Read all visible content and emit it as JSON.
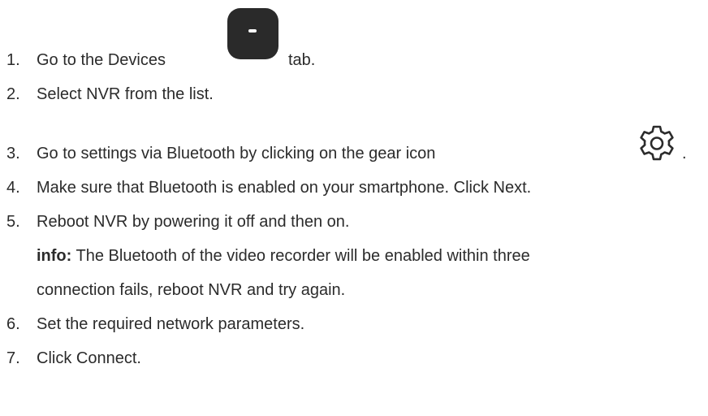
{
  "steps": [
    {
      "num": "1.",
      "before": "Go to the Devices",
      "after": "tab."
    },
    {
      "num": "2.",
      "text": "Select NVR from the list."
    },
    {
      "num": "3.",
      "before": "Go to settings via Bluetooth by clicking on the gear icon",
      "after": "."
    },
    {
      "num": "4.",
      "text": "Make sure that Bluetooth is enabled on your smartphone. Click Next."
    },
    {
      "num": "5.",
      "text": "Reboot NVR by powering it off and then on."
    },
    {
      "num": "6.",
      "text": "Set the required network parameters."
    },
    {
      "num": "7.",
      "text": "Click Connect."
    }
  ],
  "info": {
    "label": "info:",
    "line1": "The Bluetooth of the video recorder will be enabled within three",
    "line2": "connection fails, reboot NVR and try again."
  },
  "icons": {
    "devices_tab": "devices-tab-icon",
    "gear": "gear-icon"
  }
}
